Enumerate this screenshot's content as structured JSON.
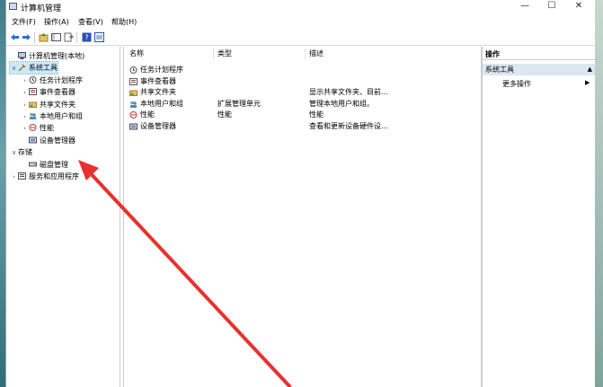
{
  "window": {
    "title": "计算机管理"
  },
  "menu": [
    "文件(F)",
    "操作(A)",
    "查看(V)",
    "帮助(H)"
  ],
  "toolbar": {
    "icons": [
      "back-arrow-icon",
      "forward-arrow-icon",
      "folder-up-icon",
      "console-tree-icon",
      "export-list-icon",
      "help-icon",
      "properties-icon"
    ]
  },
  "tree": [
    {
      "label": "计算机管理(本地)",
      "level": 0,
      "toggle": "",
      "icon": "computer-icon"
    },
    {
      "label": "系统工具",
      "level": 0,
      "toggle": "∨",
      "icon": "tools-icon",
      "selected": true
    },
    {
      "label": "任务计划程序",
      "level": 1,
      "toggle": "›",
      "icon": "clock-icon"
    },
    {
      "label": "事件查看器",
      "level": 1,
      "toggle": "›",
      "icon": "event-viewer-icon"
    },
    {
      "label": "共享文件夹",
      "level": 1,
      "toggle": "›",
      "icon": "shared-folder-icon"
    },
    {
      "label": "本地用户和组",
      "level": 1,
      "toggle": "›",
      "icon": "users-icon"
    },
    {
      "label": "性能",
      "level": 1,
      "toggle": "›",
      "icon": "performance-icon"
    },
    {
      "label": "设备管理器",
      "level": 1,
      "toggle": "",
      "icon": "device-manager-icon"
    },
    {
      "label": "存储",
      "level": 0,
      "toggle": "∨",
      "icon": ""
    },
    {
      "label": "磁盘管理",
      "level": 1,
      "toggle": "",
      "icon": "disk-icon"
    },
    {
      "label": "服务和应用程序",
      "level": 0,
      "toggle": "›",
      "icon": "services-icon"
    }
  ],
  "list": {
    "columns": [
      "名称",
      "类型",
      "描述"
    ],
    "rows": [
      {
        "name": "任务计划程序",
        "type": "",
        "desc": "",
        "icon": "clock-icon"
      },
      {
        "name": "事件查看器",
        "type": "",
        "desc": "",
        "icon": "event-viewer-icon"
      },
      {
        "name": "共享文件夹",
        "type": "",
        "desc": "显示共享文件夹、目前...",
        "icon": "shared-folder-icon"
      },
      {
        "name": "本地用户和组",
        "type": "扩展管理单元",
        "desc": "管理本地用户和组。",
        "icon": "users-icon"
      },
      {
        "name": "性能",
        "type": "性能",
        "desc": "性能",
        "icon": "performance-icon"
      },
      {
        "name": "设备管理器",
        "type": "",
        "desc": "查看和更新设备硬件设...",
        "icon": "device-manager-icon"
      }
    ]
  },
  "actions": {
    "header": "操作",
    "section": "系统工具",
    "item": "更多操作"
  },
  "colors": {
    "annotation_arrow": "#e8312f",
    "selection": "#cce8ff"
  }
}
